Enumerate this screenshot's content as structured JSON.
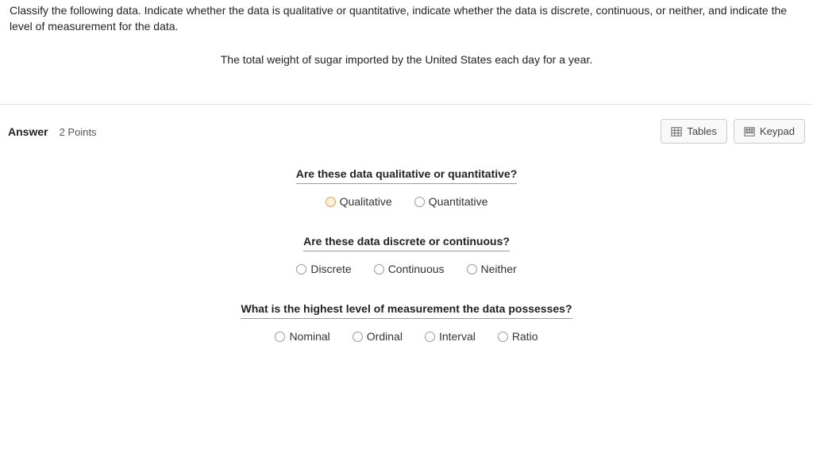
{
  "question": {
    "instructions": "Classify the following data. Indicate whether the data is qualitative or quantitative, indicate whether the data is discrete, continuous, or neither, and indicate the level of measurement for the data.",
    "prompt": "The total weight of sugar imported by the United States each day for a year."
  },
  "answer_header": {
    "label": "Answer",
    "points": "2 Points",
    "tables_btn": "Tables",
    "keypad_btn": "Keypad"
  },
  "sub_questions": [
    {
      "title": "Are these data qualitative or quantitative?",
      "options": [
        "Qualitative",
        "Quantitative"
      ]
    },
    {
      "title": "Are these data discrete or continuous?",
      "options": [
        "Discrete",
        "Continuous",
        "Neither"
      ]
    },
    {
      "title": "What is the highest level of measurement the data possesses?",
      "options": [
        "Nominal",
        "Ordinal",
        "Interval",
        "Ratio"
      ]
    }
  ]
}
